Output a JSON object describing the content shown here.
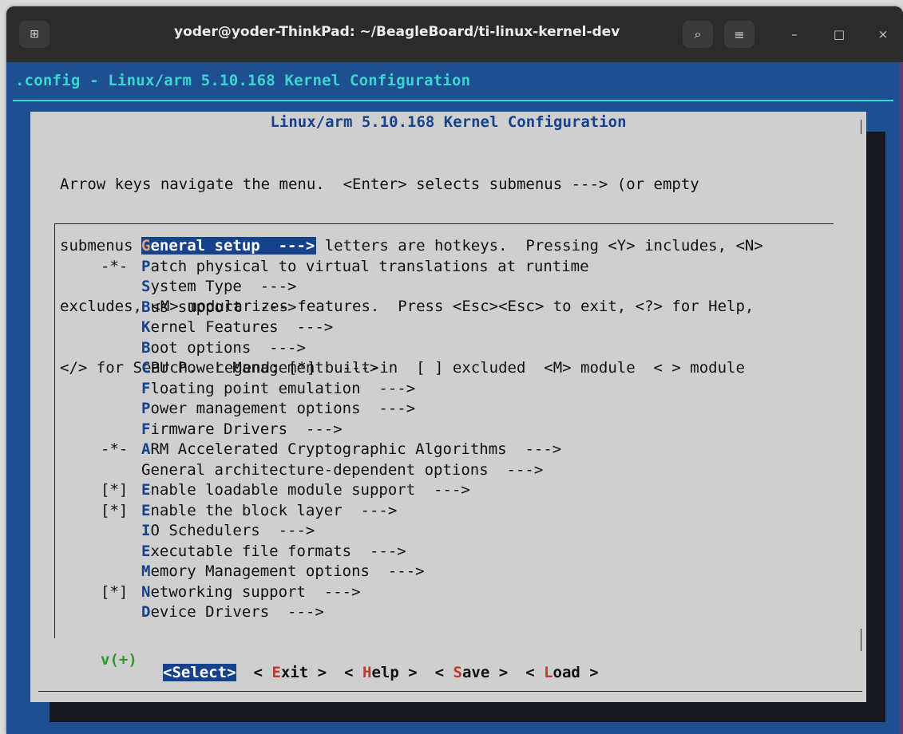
{
  "window": {
    "title": "yoder@yoder-ThinkPad: ~/BeagleBoard/ti-linux-kernel-dev",
    "new_tab_icon": "⊞",
    "search_icon": "⌕",
    "menu_icon": "≡",
    "minimize_icon": "–",
    "maximize_icon": "□",
    "close_icon": "×"
  },
  "terminal": {
    "header": ".config - Linux/arm 5.10.168 Kernel Configuration"
  },
  "dialog": {
    "title": "Linux/arm 5.10.168 Kernel Configuration",
    "help": [
      "Arrow keys navigate the menu.  <Enter> selects submenus ---> (or empty",
      "submenus ----).  Highlighted letters are hotkeys.  Pressing <Y> includes, <N>",
      "excludes, <M> modularizes features.  Press <Esc><Esc> to exit, <?> for Help,",
      "</> for Search.  Legend: [*] built-in  [ ] excluded  <M> module  < > module"
    ],
    "menu": [
      {
        "prefix": "",
        "hot": "G",
        "rest": "eneral setup  --->",
        "selected": true
      },
      {
        "prefix": "-*-",
        "hot": "P",
        "rest": "atch physical to virtual translations at runtime"
      },
      {
        "prefix": "",
        "hot": "S",
        "rest": "ystem Type  --->"
      },
      {
        "prefix": "",
        "hot": "B",
        "rest": "us support  --->"
      },
      {
        "prefix": "",
        "hot": "K",
        "rest": "ernel Features  --->"
      },
      {
        "prefix": "",
        "hot": "B",
        "rest": "oot options  --->"
      },
      {
        "prefix": "",
        "hot": "C",
        "rest": "PU Power Management  --->"
      },
      {
        "prefix": "",
        "hot": "F",
        "rest": "loating point emulation  --->"
      },
      {
        "prefix": "",
        "hot": "P",
        "rest": "ower management options  --->"
      },
      {
        "prefix": "",
        "hot": "F",
        "rest": "irmware Drivers  --->"
      },
      {
        "prefix": "-*-",
        "hot": "A",
        "rest": "RM Accelerated Cryptographic Algorithms  --->"
      },
      {
        "prefix": "",
        "hot": "",
        "rest": "General architecture-dependent options  --->"
      },
      {
        "prefix": "[*]",
        "hot": "E",
        "rest": "nable loadable module support  --->"
      },
      {
        "prefix": "[*]",
        "hot": "E",
        "rest": "nable the block layer  --->"
      },
      {
        "prefix": "",
        "hot": "I",
        "rest": "O Schedulers  --->"
      },
      {
        "prefix": "",
        "hot": "E",
        "rest": "xecutable file formats  --->"
      },
      {
        "prefix": "",
        "hot": "M",
        "rest": "emory Management options  --->"
      },
      {
        "prefix": "[*]",
        "hot": "N",
        "rest": "etworking support  --->"
      },
      {
        "prefix": "",
        "hot": "D",
        "rest": "evice Drivers  --->"
      }
    ],
    "more_indicator": "v(+)",
    "buttons": [
      {
        "pre": "<",
        "hot": "S",
        "post": "elect>",
        "selected": true
      },
      {
        "pre": "< ",
        "hot": "E",
        "post": "xit >"
      },
      {
        "pre": "< ",
        "hot": "H",
        "post": "elp >"
      },
      {
        "pre": "< ",
        "hot": "S",
        "post": "ave >"
      },
      {
        "pre": "< ",
        "hot": "L",
        "post": "oad >"
      }
    ]
  }
}
